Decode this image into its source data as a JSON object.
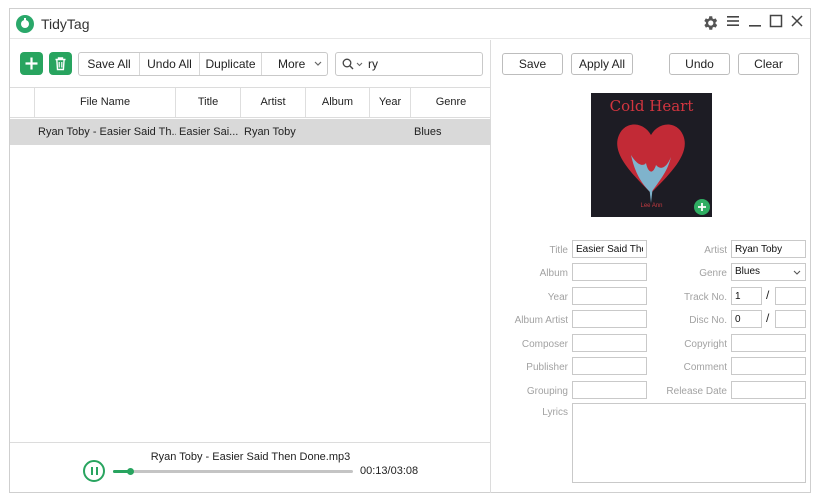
{
  "app": {
    "title": "TidyTag",
    "accent": "#28a45f"
  },
  "window_controls": [
    "gear-icon",
    "menu-icon",
    "minimize-icon",
    "maximize-icon",
    "close-icon"
  ],
  "toolbar": {
    "add_icon": "plus-icon",
    "delete_icon": "trash-icon",
    "save_all": "Save All",
    "undo_all": "Undo All",
    "duplicate": "Duplicate",
    "more": "More",
    "search_value": "ry"
  },
  "table": {
    "columns": [
      "",
      "File Name",
      "Title",
      "Artist",
      "Album",
      "Year",
      "Genre"
    ],
    "rows": [
      {
        "file_name": "Ryan Toby - Easier Said Th...",
        "title": "Easier Sai...",
        "artist": "Ryan Toby",
        "album": "",
        "year": "",
        "genre": "Blues",
        "selected": true
      }
    ]
  },
  "player": {
    "file": "Ryan Toby - Easier Said Then Done.mp3",
    "time": "00:13/03:08",
    "progress": 0.07
  },
  "editor": {
    "buttons": {
      "save": "Save",
      "apply_all": "Apply All",
      "undo": "Undo",
      "clear": "Clear"
    },
    "cover": {
      "title": "Cold Heart",
      "artist": "Lee Ann"
    },
    "labels": {
      "title": "Title",
      "artist": "Artist",
      "album": "Album",
      "genre": "Genre",
      "year": "Year",
      "track_no": "Track No.",
      "album_artist": "Album Artist",
      "disc_no": "Disc No.",
      "composer": "Composer",
      "copyright": "Copyright",
      "publisher": "Publisher",
      "comment": "Comment",
      "grouping": "Grouping",
      "release_date": "Release Date",
      "lyrics": "Lyrics"
    },
    "values": {
      "title": "Easier Said Then Done",
      "artist": "Ryan Toby",
      "album": "",
      "genre": "Blues",
      "year": "",
      "track_no": "1",
      "track_total": "",
      "album_artist": "",
      "disc_no": "0",
      "disc_total": "",
      "composer": "",
      "copyright": "",
      "publisher": "",
      "comment": "",
      "grouping": "",
      "release_date": "",
      "lyrics": ""
    }
  }
}
